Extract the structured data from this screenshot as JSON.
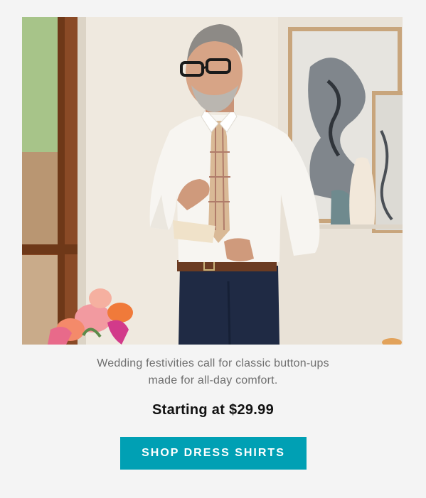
{
  "hero": {
    "alt": "Man in a white dress shirt and plaid tie holding a card"
  },
  "copy": {
    "line1": "Wedding festivities call for classic button-ups",
    "line2": "made for all-day comfort."
  },
  "price": {
    "text": "Starting at $29.99"
  },
  "cta": {
    "label": "SHOP DRESS SHIRTS"
  },
  "colors": {
    "background": "#f4f4f4",
    "cta": "#00a0b4",
    "cta_text": "#ffffff",
    "body_text": "#6f6f6f",
    "price_text": "#111111"
  }
}
